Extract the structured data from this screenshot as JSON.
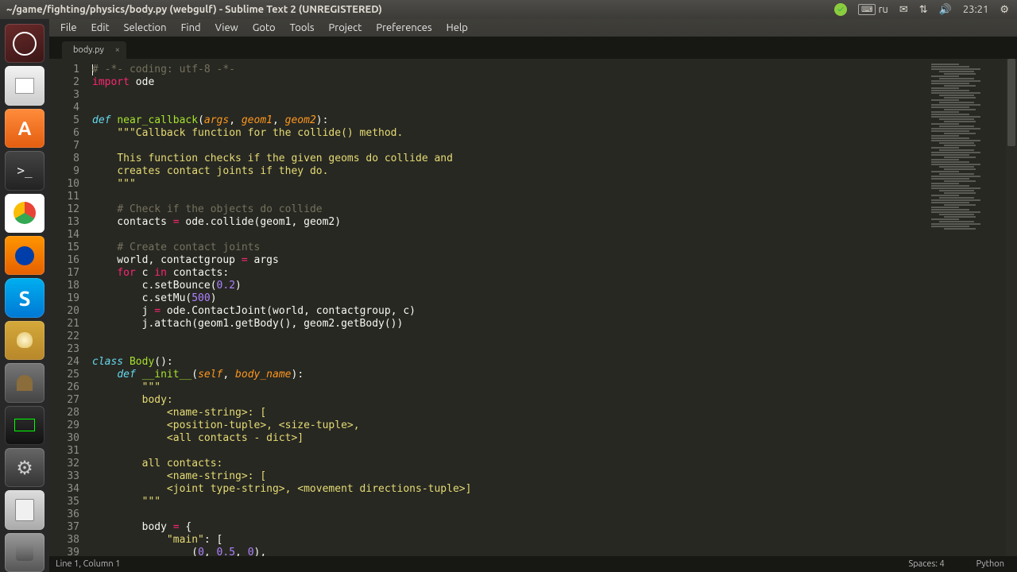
{
  "panel": {
    "title": "~/game/fighting/physics/body.py (webgulf) - Sublime Text 2 (UNREGISTERED)",
    "kbd_layout": "ru",
    "time": "23:21"
  },
  "menubar": [
    "File",
    "Edit",
    "Selection",
    "Find",
    "View",
    "Goto",
    "Tools",
    "Project",
    "Preferences",
    "Help"
  ],
  "tab": {
    "label": "body.py"
  },
  "code_lines": [
    {
      "n": 1,
      "seg": [
        [
          "caret",
          ""
        ],
        [
          "cmt",
          "# -*- coding: utf-8 -*-"
        ]
      ]
    },
    {
      "n": 2,
      "seg": [
        [
          "kw",
          "import"
        ],
        [
          "plain",
          " ode"
        ]
      ]
    },
    {
      "n": 3,
      "seg": []
    },
    {
      "n": 4,
      "seg": []
    },
    {
      "n": 5,
      "seg": [
        [
          "def",
          "def "
        ],
        [
          "fn",
          "near_callback"
        ],
        [
          "plain",
          "("
        ],
        [
          "arg",
          "args"
        ],
        [
          "plain",
          ", "
        ],
        [
          "arg",
          "geom1"
        ],
        [
          "plain",
          ", "
        ],
        [
          "arg",
          "geom2"
        ],
        [
          "plain",
          "):"
        ]
      ]
    },
    {
      "n": 6,
      "seg": [
        [
          "plain",
          "    "
        ],
        [
          "str",
          "\"\"\"Callback function for the collide() method."
        ]
      ]
    },
    {
      "n": 7,
      "seg": []
    },
    {
      "n": 8,
      "seg": [
        [
          "plain",
          "    "
        ],
        [
          "str",
          "This function checks if the given geoms do collide and"
        ]
      ]
    },
    {
      "n": 9,
      "seg": [
        [
          "plain",
          "    "
        ],
        [
          "str",
          "creates contact joints if they do."
        ]
      ]
    },
    {
      "n": 10,
      "seg": [
        [
          "plain",
          "    "
        ],
        [
          "str",
          "\"\"\""
        ]
      ]
    },
    {
      "n": 11,
      "seg": []
    },
    {
      "n": 12,
      "seg": [
        [
          "plain",
          "    "
        ],
        [
          "cmt",
          "# Check if the objects do collide"
        ]
      ]
    },
    {
      "n": 13,
      "seg": [
        [
          "plain",
          "    contacts "
        ],
        [
          "op",
          "="
        ],
        [
          "plain",
          " ode.collide(geom1, geom2)"
        ]
      ]
    },
    {
      "n": 14,
      "seg": []
    },
    {
      "n": 15,
      "seg": [
        [
          "plain",
          "    "
        ],
        [
          "cmt",
          "# Create contact joints"
        ]
      ]
    },
    {
      "n": 16,
      "seg": [
        [
          "plain",
          "    world, contactgroup "
        ],
        [
          "op",
          "="
        ],
        [
          "plain",
          " args"
        ]
      ]
    },
    {
      "n": 17,
      "seg": [
        [
          "plain",
          "    "
        ],
        [
          "kw",
          "for"
        ],
        [
          "plain",
          " c "
        ],
        [
          "kw",
          "in"
        ],
        [
          "plain",
          " contacts:"
        ]
      ]
    },
    {
      "n": 18,
      "seg": [
        [
          "plain",
          "        c.setBounce("
        ],
        [
          "num",
          "0.2"
        ],
        [
          "plain",
          ")"
        ]
      ]
    },
    {
      "n": 19,
      "seg": [
        [
          "plain",
          "        c.setMu("
        ],
        [
          "num",
          "500"
        ],
        [
          "plain",
          ")"
        ]
      ]
    },
    {
      "n": 20,
      "seg": [
        [
          "plain",
          "        j "
        ],
        [
          "op",
          "="
        ],
        [
          "plain",
          " ode.ContactJoint(world, contactgroup, c)"
        ]
      ]
    },
    {
      "n": 21,
      "seg": [
        [
          "plain",
          "        j.attach(geom1.getBody(), geom2.getBody())"
        ]
      ]
    },
    {
      "n": 22,
      "seg": []
    },
    {
      "n": 23,
      "seg": []
    },
    {
      "n": 24,
      "seg": [
        [
          "def",
          "class "
        ],
        [
          "fn",
          "Body"
        ],
        [
          "plain",
          "():"
        ]
      ]
    },
    {
      "n": 25,
      "seg": [
        [
          "plain",
          "    "
        ],
        [
          "def",
          "def "
        ],
        [
          "fn",
          "__init__"
        ],
        [
          "plain",
          "("
        ],
        [
          "arg",
          "self"
        ],
        [
          "plain",
          ", "
        ],
        [
          "arg",
          "body_name"
        ],
        [
          "plain",
          "):"
        ]
      ]
    },
    {
      "n": 26,
      "seg": [
        [
          "plain",
          "        "
        ],
        [
          "str",
          "\"\"\""
        ]
      ]
    },
    {
      "n": 27,
      "seg": [
        [
          "plain",
          "        "
        ],
        [
          "str",
          "body:"
        ]
      ]
    },
    {
      "n": 28,
      "seg": [
        [
          "plain",
          "            "
        ],
        [
          "str",
          "<name-string>: ["
        ]
      ]
    },
    {
      "n": 29,
      "seg": [
        [
          "plain",
          "            "
        ],
        [
          "str",
          "<position-tuple>, <size-tuple>,"
        ]
      ]
    },
    {
      "n": 30,
      "seg": [
        [
          "plain",
          "            "
        ],
        [
          "str",
          "<all contacts - dict>]"
        ]
      ]
    },
    {
      "n": 31,
      "seg": []
    },
    {
      "n": 32,
      "seg": [
        [
          "plain",
          "        "
        ],
        [
          "str",
          "all contacts:"
        ]
      ]
    },
    {
      "n": 33,
      "seg": [
        [
          "plain",
          "            "
        ],
        [
          "str",
          "<name-string>: ["
        ]
      ]
    },
    {
      "n": 34,
      "seg": [
        [
          "plain",
          "            "
        ],
        [
          "str",
          "<joint type-string>, <movement directions-tuple>]"
        ]
      ]
    },
    {
      "n": 35,
      "seg": [
        [
          "plain",
          "        "
        ],
        [
          "str",
          "\"\"\""
        ]
      ]
    },
    {
      "n": 36,
      "seg": []
    },
    {
      "n": 37,
      "seg": [
        [
          "plain",
          "        body "
        ],
        [
          "op",
          "="
        ],
        [
          "plain",
          " {"
        ]
      ]
    },
    {
      "n": 38,
      "seg": [
        [
          "plain",
          "            "
        ],
        [
          "str",
          "\"main\""
        ],
        [
          "plain",
          ": ["
        ]
      ]
    },
    {
      "n": 39,
      "seg": [
        [
          "plain",
          "                ("
        ],
        [
          "num",
          "0"
        ],
        [
          "plain",
          ", "
        ],
        [
          "num",
          "0.5"
        ],
        [
          "plain",
          ", "
        ],
        [
          "num",
          "0"
        ],
        [
          "plain",
          "),"
        ]
      ]
    }
  ],
  "statusbar": {
    "position": "Line 1, Column 1",
    "spaces": "Spaces: 4",
    "syntax": "Python"
  }
}
